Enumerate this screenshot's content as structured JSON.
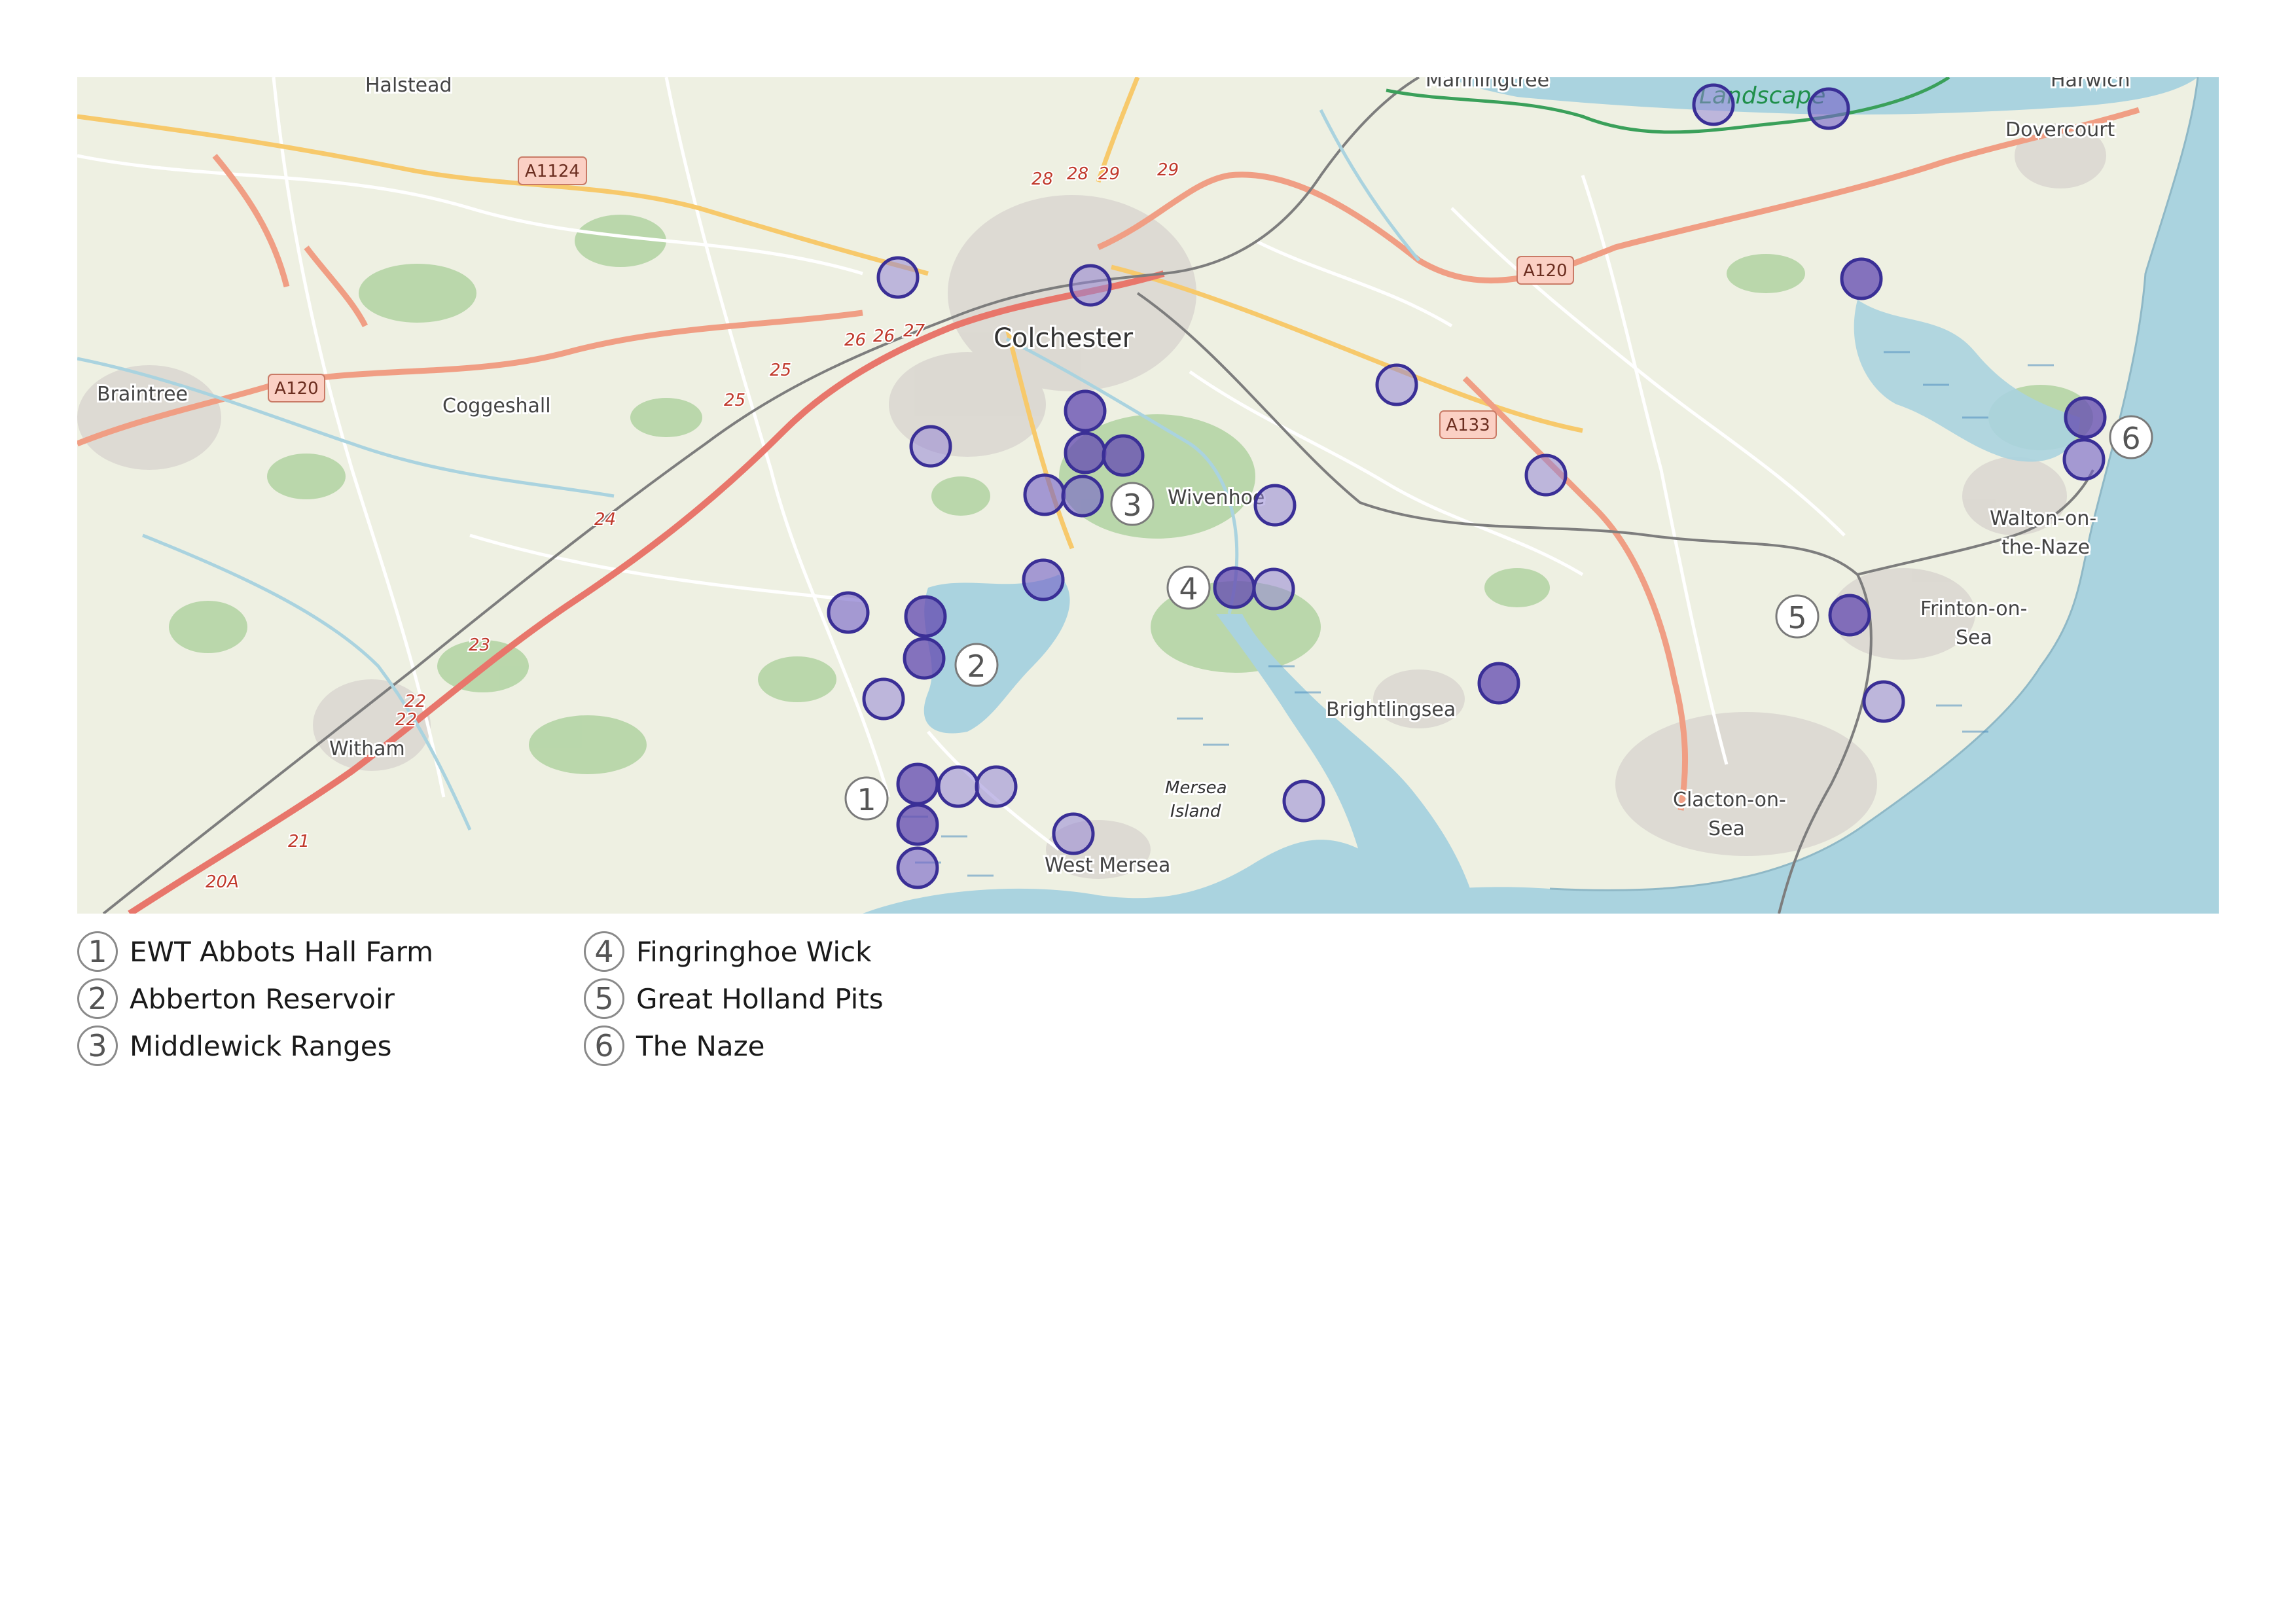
{
  "map": {
    "places": [
      {
        "name": "Halstead"
      },
      {
        "name": "Manningtree"
      },
      {
        "name": "Harwich"
      },
      {
        "name": "Dovercourt"
      },
      {
        "name": "Colchester"
      },
      {
        "name": "Braintree"
      },
      {
        "name": "Coggeshall"
      },
      {
        "name": "Wivenhoe"
      },
      {
        "name": "Walton-on-"
      },
      {
        "name": "the-Naze"
      },
      {
        "name": "Frinton-on-"
      },
      {
        "name": "Sea"
      },
      {
        "name": "Brightlingsea"
      },
      {
        "name": "Witham"
      },
      {
        "name": "Mersea"
      },
      {
        "name": "Island"
      },
      {
        "name": "West Mersea"
      },
      {
        "name": "Clacton-on-"
      },
      {
        "name": "Sea"
      }
    ],
    "road_shields": [
      "A1124",
      "A120",
      "A120",
      "A133"
    ],
    "junctions": [
      "28",
      "28",
      "29",
      "29",
      "26",
      "26",
      "27",
      "25",
      "25",
      "24",
      "23",
      "22",
      "22",
      "21",
      "20A"
    ],
    "landscape_label": "Landscape",
    "site_color": "#7664c8",
    "site_stroke": "#3a2f96",
    "sea_color": "#aad3df",
    "land_color": "#eef0e2",
    "number_badges": [
      "1",
      "2",
      "3",
      "4",
      "5",
      "6"
    ]
  },
  "legend": {
    "items": [
      {
        "num": "1",
        "label": "EWT Abbots Hall Farm"
      },
      {
        "num": "2",
        "label": "Abberton Reservoir"
      },
      {
        "num": "3",
        "label": "Middlewick Ranges"
      },
      {
        "num": "4",
        "label": "Fingringhoe Wick"
      },
      {
        "num": "5",
        "label": "Great Holland Pits"
      },
      {
        "num": "6",
        "label": "The Naze"
      }
    ]
  }
}
